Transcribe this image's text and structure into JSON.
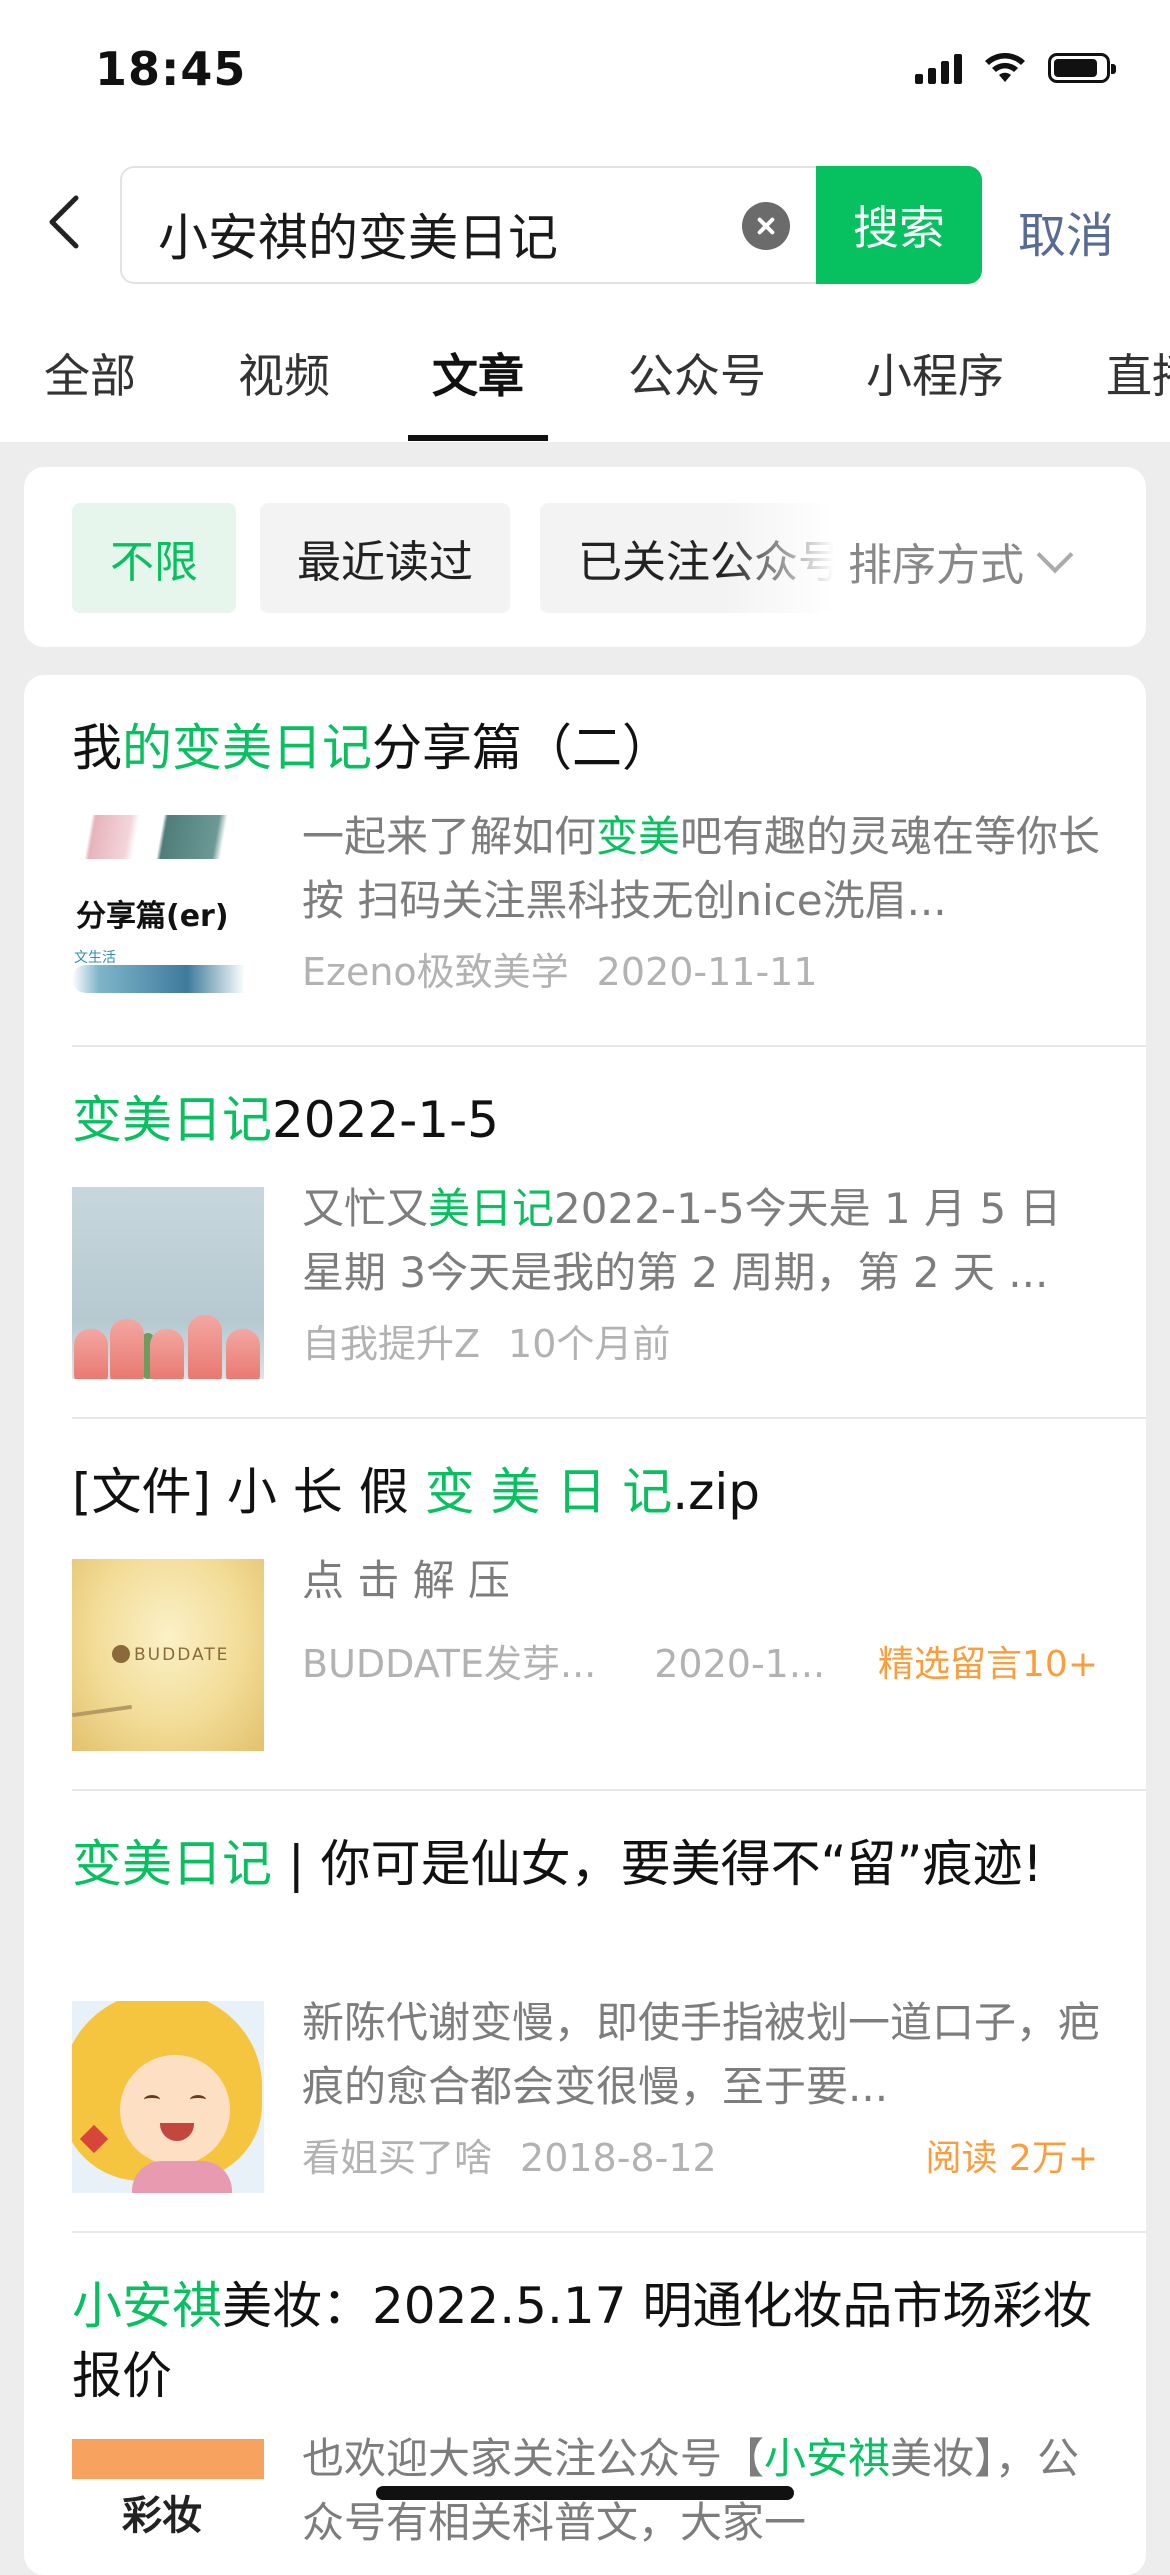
{
  "status_bar": {
    "time": "18:45"
  },
  "search": {
    "query": "小安祺的变美日记",
    "search_button": "搜索",
    "cancel_button": "取消"
  },
  "tabs": [
    {
      "label": "全部"
    },
    {
      "label": "视频"
    },
    {
      "label": "文章",
      "active": true
    },
    {
      "label": "公众号"
    },
    {
      "label": "小程序"
    },
    {
      "label": "直播"
    }
  ],
  "filters": {
    "chips": [
      {
        "label": "不限",
        "active": true
      },
      {
        "label": "最近读过"
      },
      {
        "label": "已关注公众号"
      }
    ],
    "sort_label": "排序方式"
  },
  "results": [
    {
      "title_parts": [
        "我",
        "的变美日记",
        "分享篇（二）"
      ],
      "snippet_parts": [
        "一起来了解如何",
        "变美",
        "吧有趣的灵魂在等你长按 扫码关注黑科技无创nice洗眉..."
      ],
      "source": "Ezeno极致美学",
      "date": "2020-11-11",
      "thumb_text": "分享篇(er)",
      "thumb_small": "文生活"
    },
    {
      "title_parts": [
        "变美日记",
        "2022-1-5"
      ],
      "snippet_parts": [
        "又忙又",
        "美日记",
        "2022-1-5今天是 1 月 5 日 星期 3今天是我的第 2 周期，第 2 天 ..."
      ],
      "source": "自我提升Z",
      "date": "10个月前"
    },
    {
      "title_parts": [
        "[文件] 小 长 假 ",
        "变 美 日 记",
        ".zip"
      ],
      "snippet": "点 击 解 压",
      "source": "BUDDATE发芽...",
      "date": "2020-1...",
      "tag": "精选留言10+",
      "thumb_logo": "BUDDATE"
    },
    {
      "title_parts": [
        "变美日记",
        " | 你可是仙女，要美得不“留”痕迹!"
      ],
      "snippet": "新陈代谢变慢，即使手指被划一道口子，疤痕的愈合都会变很慢，至于要...",
      "source": "看姐买了啥",
      "date": "2018-8-12",
      "tag": "阅读 2万+"
    },
    {
      "title_parts": [
        "小安祺",
        "美妆：2022.5.17 明通化妆品市场彩妆报价"
      ],
      "snippet_parts": [
        "也欢迎大家关注公众号【",
        "小安祺",
        "美妆】，公众号有相关科普文，大家一"
      ],
      "thumb_label": "彩妆"
    }
  ]
}
